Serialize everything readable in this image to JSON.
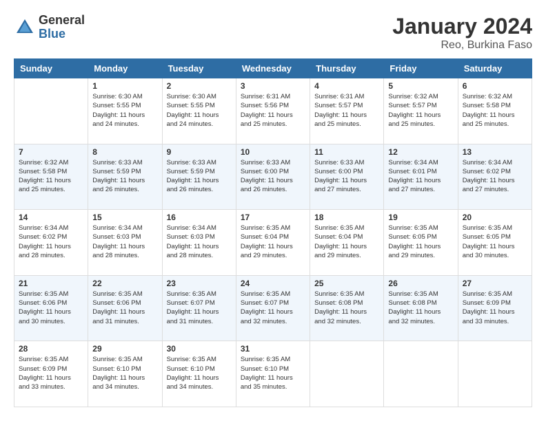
{
  "header": {
    "logo_general": "General",
    "logo_blue": "Blue",
    "main_title": "January 2024",
    "sub_title": "Reo, Burkina Faso"
  },
  "days_of_week": [
    "Sunday",
    "Monday",
    "Tuesday",
    "Wednesday",
    "Thursday",
    "Friday",
    "Saturday"
  ],
  "weeks": [
    [
      {
        "day": "",
        "info": ""
      },
      {
        "day": "1",
        "info": "Sunrise: 6:30 AM\nSunset: 5:55 PM\nDaylight: 11 hours\nand 24 minutes."
      },
      {
        "day": "2",
        "info": "Sunrise: 6:30 AM\nSunset: 5:55 PM\nDaylight: 11 hours\nand 24 minutes."
      },
      {
        "day": "3",
        "info": "Sunrise: 6:31 AM\nSunset: 5:56 PM\nDaylight: 11 hours\nand 25 minutes."
      },
      {
        "day": "4",
        "info": "Sunrise: 6:31 AM\nSunset: 5:57 PM\nDaylight: 11 hours\nand 25 minutes."
      },
      {
        "day": "5",
        "info": "Sunrise: 6:32 AM\nSunset: 5:57 PM\nDaylight: 11 hours\nand 25 minutes."
      },
      {
        "day": "6",
        "info": "Sunrise: 6:32 AM\nSunset: 5:58 PM\nDaylight: 11 hours\nand 25 minutes."
      }
    ],
    [
      {
        "day": "7",
        "info": "Sunrise: 6:32 AM\nSunset: 5:58 PM\nDaylight: 11 hours\nand 25 minutes."
      },
      {
        "day": "8",
        "info": "Sunrise: 6:33 AM\nSunset: 5:59 PM\nDaylight: 11 hours\nand 26 minutes."
      },
      {
        "day": "9",
        "info": "Sunrise: 6:33 AM\nSunset: 5:59 PM\nDaylight: 11 hours\nand 26 minutes."
      },
      {
        "day": "10",
        "info": "Sunrise: 6:33 AM\nSunset: 6:00 PM\nDaylight: 11 hours\nand 26 minutes."
      },
      {
        "day": "11",
        "info": "Sunrise: 6:33 AM\nSunset: 6:00 PM\nDaylight: 11 hours\nand 27 minutes."
      },
      {
        "day": "12",
        "info": "Sunrise: 6:34 AM\nSunset: 6:01 PM\nDaylight: 11 hours\nand 27 minutes."
      },
      {
        "day": "13",
        "info": "Sunrise: 6:34 AM\nSunset: 6:02 PM\nDaylight: 11 hours\nand 27 minutes."
      }
    ],
    [
      {
        "day": "14",
        "info": "Sunrise: 6:34 AM\nSunset: 6:02 PM\nDaylight: 11 hours\nand 28 minutes."
      },
      {
        "day": "15",
        "info": "Sunrise: 6:34 AM\nSunset: 6:03 PM\nDaylight: 11 hours\nand 28 minutes."
      },
      {
        "day": "16",
        "info": "Sunrise: 6:34 AM\nSunset: 6:03 PM\nDaylight: 11 hours\nand 28 minutes."
      },
      {
        "day": "17",
        "info": "Sunrise: 6:35 AM\nSunset: 6:04 PM\nDaylight: 11 hours\nand 29 minutes."
      },
      {
        "day": "18",
        "info": "Sunrise: 6:35 AM\nSunset: 6:04 PM\nDaylight: 11 hours\nand 29 minutes."
      },
      {
        "day": "19",
        "info": "Sunrise: 6:35 AM\nSunset: 6:05 PM\nDaylight: 11 hours\nand 29 minutes."
      },
      {
        "day": "20",
        "info": "Sunrise: 6:35 AM\nSunset: 6:05 PM\nDaylight: 11 hours\nand 30 minutes."
      }
    ],
    [
      {
        "day": "21",
        "info": "Sunrise: 6:35 AM\nSunset: 6:06 PM\nDaylight: 11 hours\nand 30 minutes."
      },
      {
        "day": "22",
        "info": "Sunrise: 6:35 AM\nSunset: 6:06 PM\nDaylight: 11 hours\nand 31 minutes."
      },
      {
        "day": "23",
        "info": "Sunrise: 6:35 AM\nSunset: 6:07 PM\nDaylight: 11 hours\nand 31 minutes."
      },
      {
        "day": "24",
        "info": "Sunrise: 6:35 AM\nSunset: 6:07 PM\nDaylight: 11 hours\nand 32 minutes."
      },
      {
        "day": "25",
        "info": "Sunrise: 6:35 AM\nSunset: 6:08 PM\nDaylight: 11 hours\nand 32 minutes."
      },
      {
        "day": "26",
        "info": "Sunrise: 6:35 AM\nSunset: 6:08 PM\nDaylight: 11 hours\nand 32 minutes."
      },
      {
        "day": "27",
        "info": "Sunrise: 6:35 AM\nSunset: 6:09 PM\nDaylight: 11 hours\nand 33 minutes."
      }
    ],
    [
      {
        "day": "28",
        "info": "Sunrise: 6:35 AM\nSunset: 6:09 PM\nDaylight: 11 hours\nand 33 minutes."
      },
      {
        "day": "29",
        "info": "Sunrise: 6:35 AM\nSunset: 6:10 PM\nDaylight: 11 hours\nand 34 minutes."
      },
      {
        "day": "30",
        "info": "Sunrise: 6:35 AM\nSunset: 6:10 PM\nDaylight: 11 hours\nand 34 minutes."
      },
      {
        "day": "31",
        "info": "Sunrise: 6:35 AM\nSunset: 6:10 PM\nDaylight: 11 hours\nand 35 minutes."
      },
      {
        "day": "",
        "info": ""
      },
      {
        "day": "",
        "info": ""
      },
      {
        "day": "",
        "info": ""
      }
    ]
  ]
}
